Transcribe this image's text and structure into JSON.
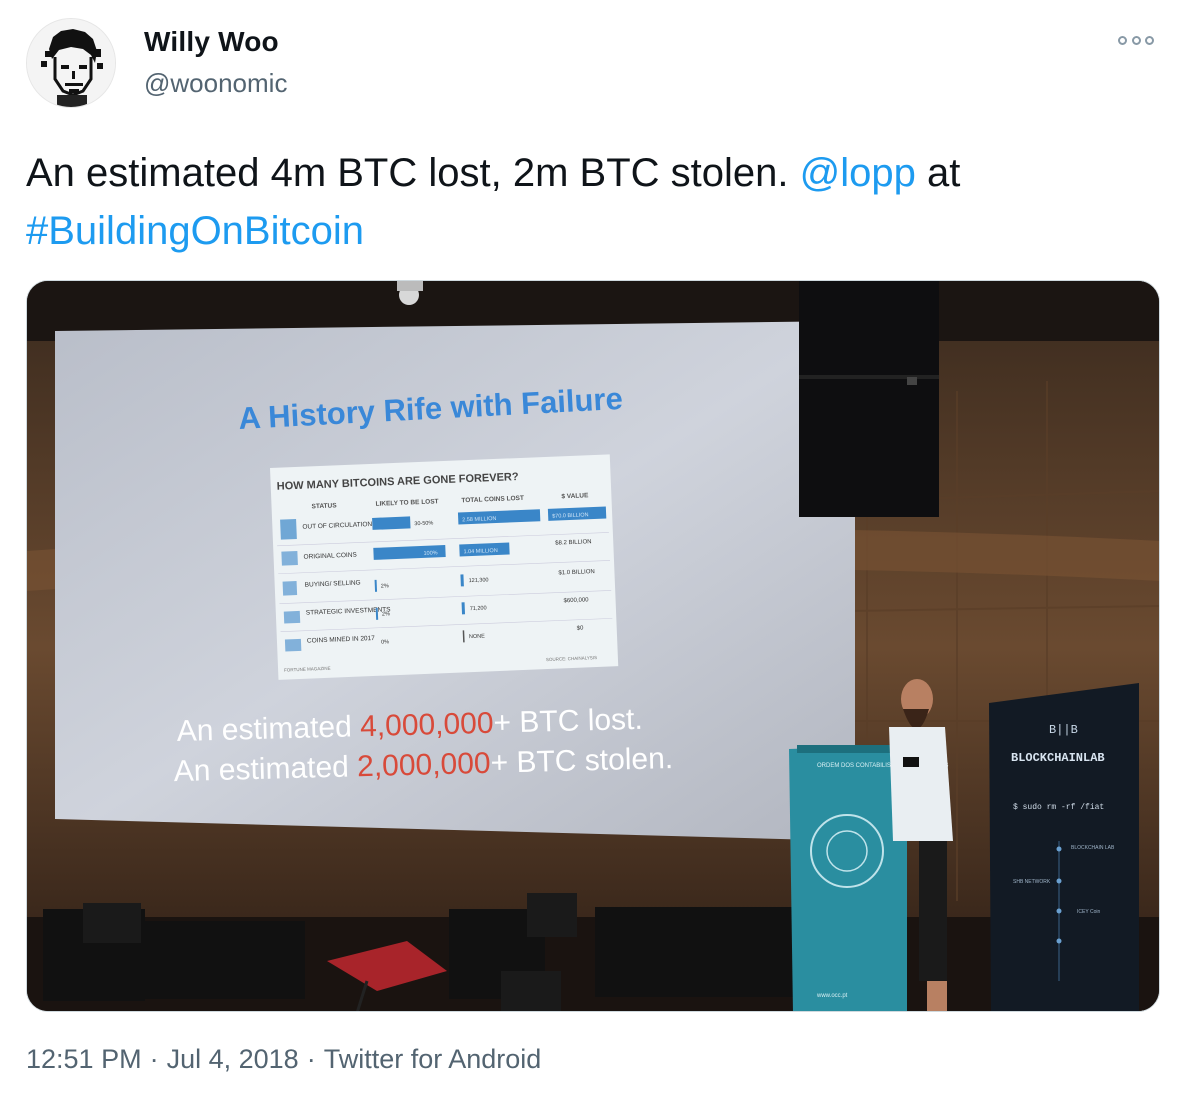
{
  "author": {
    "display_name": "Willy Woo",
    "handle": "@woonomic",
    "avatar_icon": "pixel-face-avatar"
  },
  "more_icon": "more-options-icon",
  "tweet": {
    "text_1": "An estimated 4m BTC lost, 2m BTC stolen. ",
    "mention": "@lopp",
    "text_2": " at",
    "hashtag": "#BuildingOnBitcoin"
  },
  "photo": {
    "slide_title": "A History Rife with Failure",
    "table_title": "HOW MANY BITCOINS ARE GONE FOREVER?",
    "columns": [
      "STATUS",
      "LIKELY TO BE LOST",
      "TOTAL COINS LOST",
      "$ VALUE"
    ],
    "rows": [
      {
        "status": "OUT OF CIRCULATION",
        "likely": "30-50%",
        "total": "2.58 MILLION",
        "value": "$70.0 BILLION"
      },
      {
        "status": "ORIGINAL COINS",
        "likely": "100%",
        "total": "1.04 MILLION",
        "value": "$8.2 BILLION"
      },
      {
        "status": "BUYING/ SELLING",
        "likely": "2%",
        "total": "121,300",
        "value": "$1.0 BILLION"
      },
      {
        "status": "STRATEGIC INVESTMENTS",
        "likely": "2%",
        "total": "71,200",
        "value": "$600,000"
      },
      {
        "status": "COINS MINED IN 2017",
        "likely": "0%",
        "total": "NONE",
        "value": "$0"
      }
    ],
    "footer_left": "FORTUNE MAGAZINE",
    "footer_right": "SOURCE: CHAINALYSIS",
    "line1_prefix": "An estimated ",
    "line1_number": "4,000,000",
    "line1_suffix": "+ BTC lost.",
    "line2_prefix": "An estimated ",
    "line2_number": "2,000,000",
    "line2_suffix": "+ BTC stolen.",
    "podium_text": "ORDEM DOS CONTABILISTAS CERTIFICADOS",
    "podium_url": "www.occ.pt",
    "banner_logo": "B||B",
    "banner_title": "BLOCKCHAINLAB",
    "banner_cmd": "$ sudo rm -rf /fiat",
    "banner_label_1": "BLOCKCHAIN LAB",
    "banner_label_2": "SHB NETWORK",
    "banner_label_3": "ICEY Coin",
    "speaker_icon": "loudspeaker-icon",
    "colors": {
      "screen": "#cfd3dc",
      "title_blue": "#3a88d8",
      "number_red": "#d84a3a",
      "podium": "#2a8ea0",
      "banner": "#121a24"
    }
  },
  "meta": {
    "time": "12:51 PM",
    "date": "Jul 4, 2018",
    "source": "Twitter for Android",
    "separator": "·"
  }
}
